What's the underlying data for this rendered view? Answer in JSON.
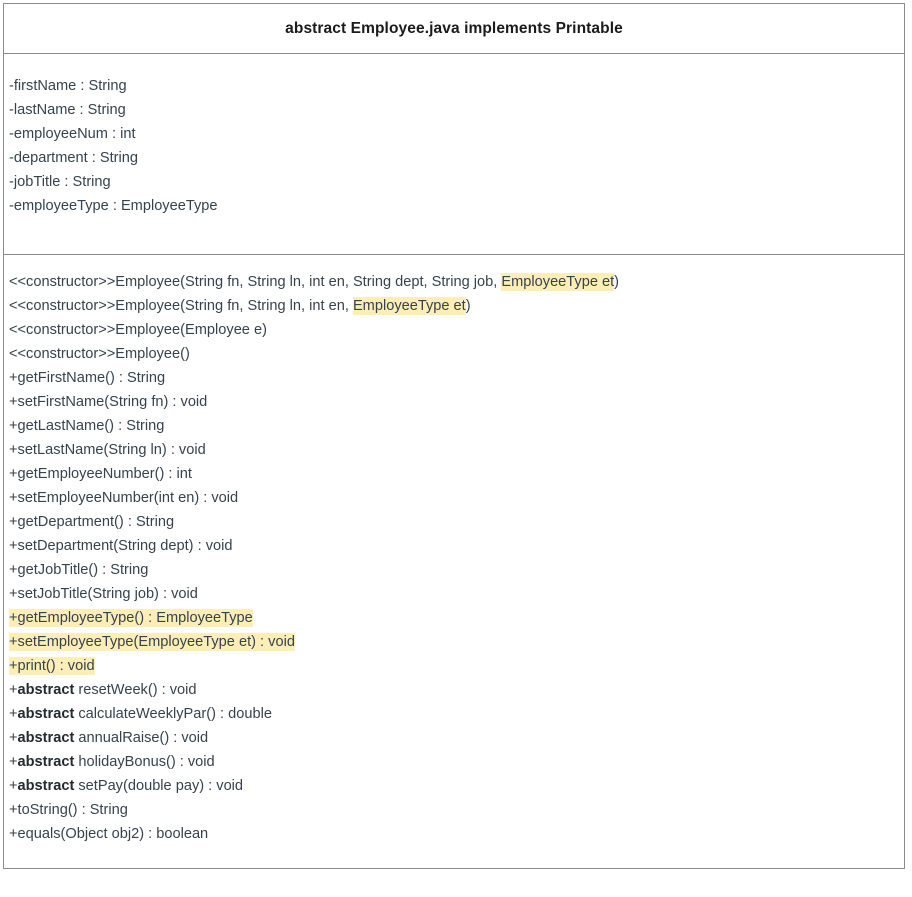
{
  "diagram": {
    "kind": "uml-class-diagram",
    "title": "abstract Employee.java implements Printable",
    "colors": {
      "border": "#8a8a8a",
      "text": "#36424d",
      "title_text": "#1b1b1b",
      "highlight": "#fdeeb8",
      "background": "#ffffff"
    },
    "attributes": [
      {
        "text": "-firstName : String"
      },
      {
        "text": "-lastName : String"
      },
      {
        "text": "-employeeNum : int"
      },
      {
        "text": "-department : String"
      },
      {
        "text": "-jobTitle : String"
      },
      {
        "text": "-employeeType : EmployeeType"
      }
    ],
    "operations": [
      {
        "segments": [
          {
            "text": "<<constructor>>Employee(String fn, String ln, int en, String dept, String job, "
          },
          {
            "text": "EmployeeType et",
            "highlight": true
          },
          {
            "text": ")"
          }
        ]
      },
      {
        "segments": [
          {
            "text": "<<constructor>>Employee(String fn, String ln, int en, "
          },
          {
            "text": "EmployeeType et",
            "highlight": true
          },
          {
            "text": ")"
          }
        ]
      },
      {
        "segments": [
          {
            "text": "<<constructor>>Employee(Employee e)"
          }
        ]
      },
      {
        "segments": [
          {
            "text": "<<constructor>>Employee()"
          }
        ]
      },
      {
        "segments": [
          {
            "text": "+getFirstName() : String"
          }
        ]
      },
      {
        "segments": [
          {
            "text": "+setFirstName(String fn) : void"
          }
        ]
      },
      {
        "segments": [
          {
            "text": "+getLastName() : String"
          }
        ]
      },
      {
        "segments": [
          {
            "text": "+setLastName(String ln) : void"
          }
        ]
      },
      {
        "segments": [
          {
            "text": "+getEmployeeNumber() : int"
          }
        ]
      },
      {
        "segments": [
          {
            "text": "+setEmployeeNumber(int en) : void"
          }
        ]
      },
      {
        "segments": [
          {
            "text": "+getDepartment() : String"
          }
        ]
      },
      {
        "segments": [
          {
            "text": "+setDepartment(String dept) : void"
          }
        ]
      },
      {
        "segments": [
          {
            "text": "+getJobTitle() : String"
          }
        ]
      },
      {
        "segments": [
          {
            "text": "+setJobTitle(String job) : void"
          }
        ]
      },
      {
        "segments": [
          {
            "text": "+getEmployeeType() : EmployeeType",
            "highlight": true
          }
        ]
      },
      {
        "segments": [
          {
            "text": "+setEmployeeType(EmployeeType et) : void",
            "highlight": true
          }
        ]
      },
      {
        "segments": [
          {
            "text": "+print() : void",
            "highlight": true
          }
        ]
      },
      {
        "segments": [
          {
            "text": "+"
          },
          {
            "text": "abstract",
            "bold": true
          },
          {
            "text": " resetWeek() : void"
          }
        ]
      },
      {
        "segments": [
          {
            "text": "+"
          },
          {
            "text": "abstract",
            "bold": true
          },
          {
            "text": " calculateWeeklyPar() : double"
          }
        ]
      },
      {
        "segments": [
          {
            "text": "+"
          },
          {
            "text": "abstract",
            "bold": true
          },
          {
            "text": " annualRaise() : void"
          }
        ]
      },
      {
        "segments": [
          {
            "text": "+"
          },
          {
            "text": "abstract",
            "bold": true
          },
          {
            "text": " holidayBonus() : void"
          }
        ]
      },
      {
        "segments": [
          {
            "text": "+"
          },
          {
            "text": "abstract",
            "bold": true
          },
          {
            "text": " setPay(double pay) : void"
          }
        ]
      },
      {
        "segments": [
          {
            "text": "+toString() : String"
          }
        ]
      },
      {
        "segments": [
          {
            "text": "+equals(Object obj2) : boolean"
          }
        ]
      }
    ]
  }
}
